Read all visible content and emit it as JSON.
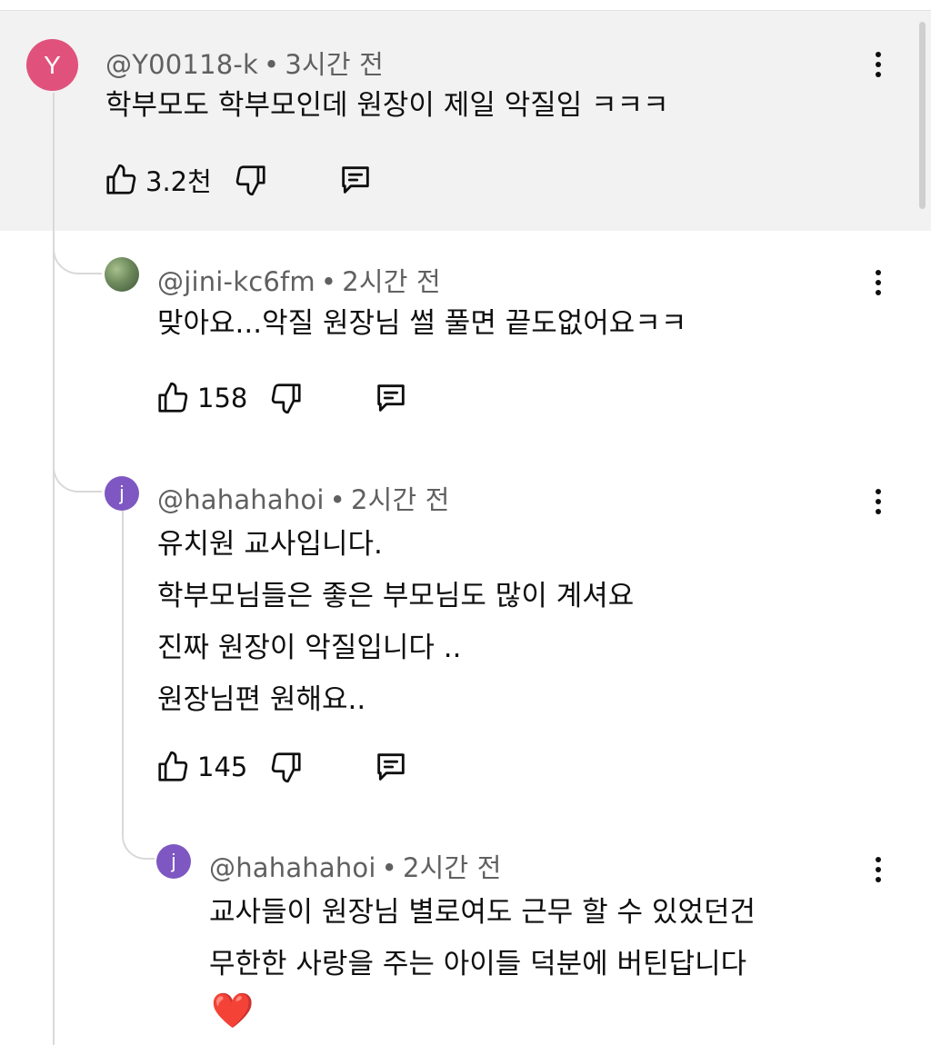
{
  "comments": [
    {
      "avatar_letter": "Y",
      "avatar_color": "#e0527c",
      "author": "@Y00118-k",
      "time": "3시간 전",
      "text": "학부모도 학부모인데 원장이 제일 악질임 ㅋㅋㅋ",
      "likes": "3.2천",
      "highlighted": true
    },
    {
      "avatar_letter": "",
      "avatar_color": "#6e8a5c",
      "author": "@jini-kc6fm",
      "time": "2시간 전",
      "text": "맞아요...악질 원장님 썰 풀면 끝도없어요ㅋㅋ",
      "likes": "158"
    },
    {
      "avatar_letter": "j",
      "avatar_color": "#7e57c2",
      "author": "@hahahahoi",
      "time": "2시간 전",
      "text": "유치원 교사입니다.\n학부모님들은 좋은 부모님도 많이 계셔요\n진짜 원장이 악질입니다 ..\n원장님편 원해요..",
      "likes": "145"
    },
    {
      "avatar_letter": "j",
      "avatar_color": "#7e57c2",
      "author": "@hahahahoi",
      "time": "2시간 전",
      "text": "교사들이 원장님 별로여도 근무 할 수 있었던건\n무한한 사랑을 주는 아이들 덕분에 버틴답니다",
      "emoji": "❤️"
    }
  ],
  "separator": "•",
  "icons": [
    "thumbs-up-icon",
    "thumbs-down-icon",
    "reply-icon",
    "more-vert-icon"
  ]
}
